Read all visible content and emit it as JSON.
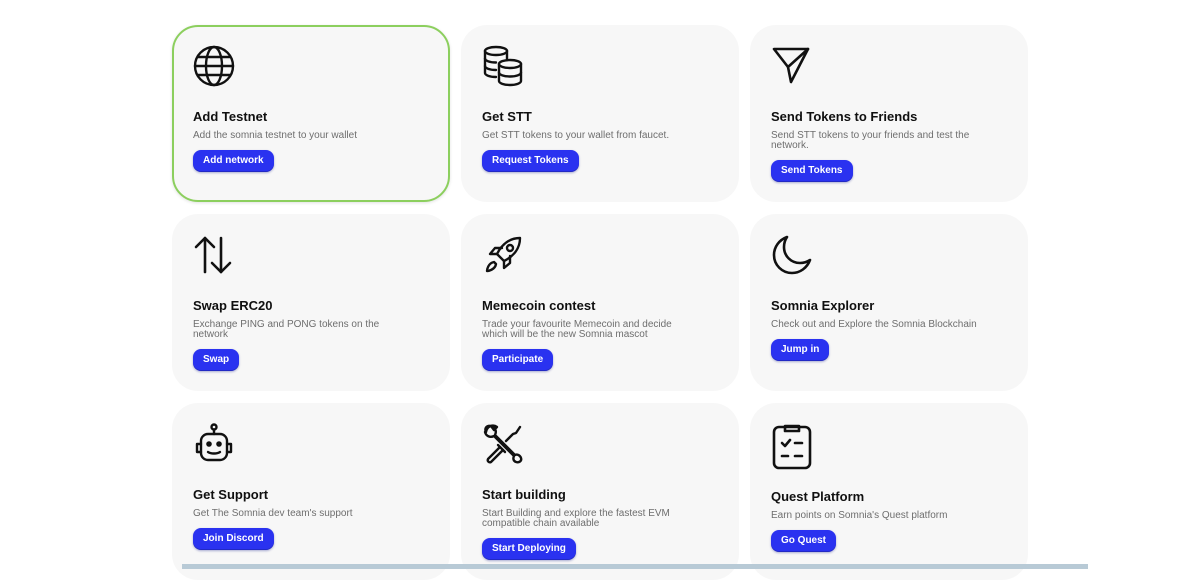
{
  "cards": [
    {
      "icon": "globe-icon",
      "title": "Add Testnet",
      "description": "Add the somnia testnet to your wallet",
      "button": "Add network"
    },
    {
      "icon": "database-coins-icon",
      "title": "Get STT",
      "description": "Get STT tokens to your wallet from faucet.",
      "button": "Request Tokens"
    },
    {
      "icon": "paper-plane-icon",
      "title": "Send Tokens to Friends",
      "description": "Send STT tokens to your friends and test the network.",
      "button": "Send Tokens"
    },
    {
      "icon": "swap-arrows-icon",
      "title": "Swap ERC20",
      "description": "Exchange PING and PONG tokens on the network",
      "button": "Swap"
    },
    {
      "icon": "rocket-icon",
      "title": "Memecoin contest",
      "description": "Trade your favourite Memecoin and decide which will be the new Somnia mascot",
      "button": "Participate"
    },
    {
      "icon": "moon-icon",
      "title": "Somnia Explorer",
      "description": "Check out and Explore the Somnia Blockchain",
      "button": "Jump in"
    },
    {
      "icon": "robot-icon",
      "title": "Get Support",
      "description": "Get The Somnia dev team's support",
      "button": "Join Discord"
    },
    {
      "icon": "tools-icon",
      "title": "Start building",
      "description": "Start Building and explore the fastest EVM compatible chain available",
      "button": "Start Deploying"
    },
    {
      "icon": "clipboard-check-icon",
      "title": "Quest Platform",
      "description": "Earn points on Somnia's Quest platform",
      "button": "Go Quest"
    }
  ],
  "colors": {
    "accent": "#2a32f0",
    "active_border": "#8ccf5e",
    "card_bg": "#f7f7f7"
  }
}
